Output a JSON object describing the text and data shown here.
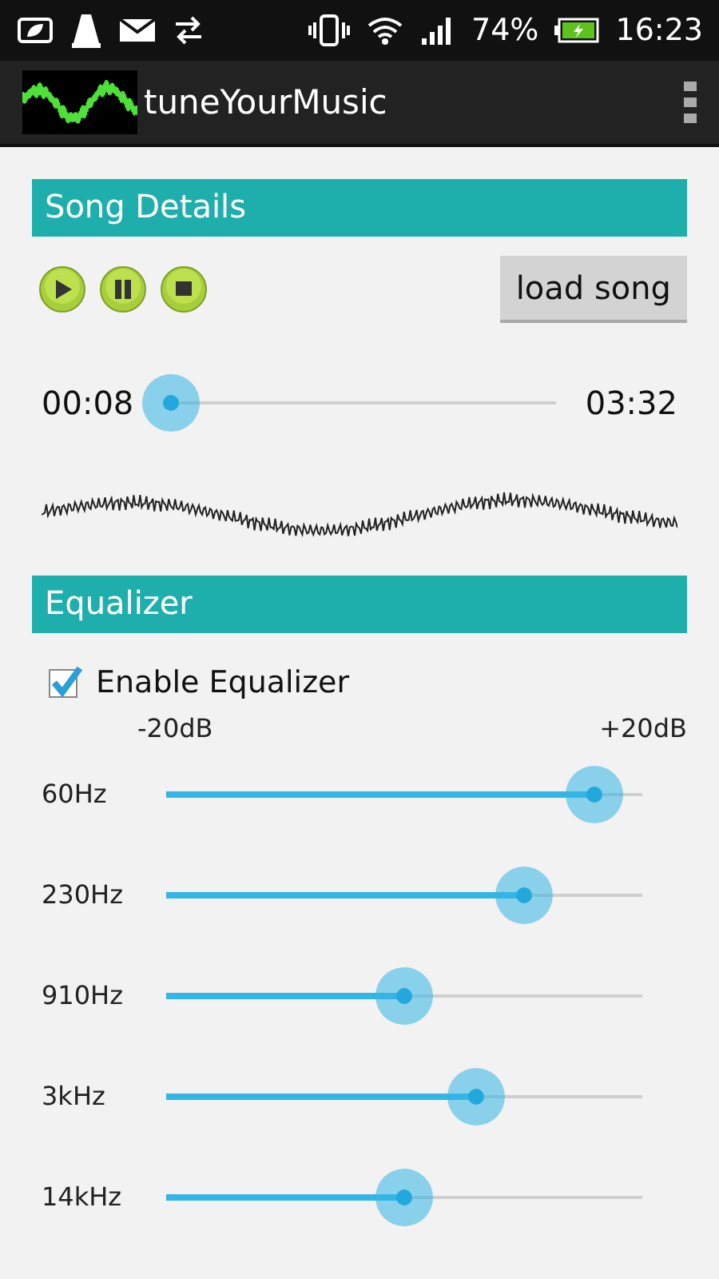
{
  "status_bar": {
    "battery": "74%",
    "time": "16:23"
  },
  "action_bar": {
    "title": "tuneYourMusic"
  },
  "song_details": {
    "title": "Song Details",
    "load_button": "load song",
    "elapsed": "00:08",
    "duration": "03:32",
    "seek": {
      "level": 0.02
    }
  },
  "equalizer": {
    "title": "Equalizer",
    "enable": {
      "label": "Enable Equalizer",
      "checked": true
    },
    "min_label": "-20dB",
    "max_label": "+20dB",
    "bands": [
      {
        "label": "60Hz",
        "level": 0.9
      },
      {
        "label": "230Hz",
        "level": 0.75
      },
      {
        "label": "910Hz",
        "level": 0.5
      },
      {
        "label": "3kHz",
        "level": 0.65
      },
      {
        "label": "14kHz",
        "level": 0.5
      }
    ]
  }
}
